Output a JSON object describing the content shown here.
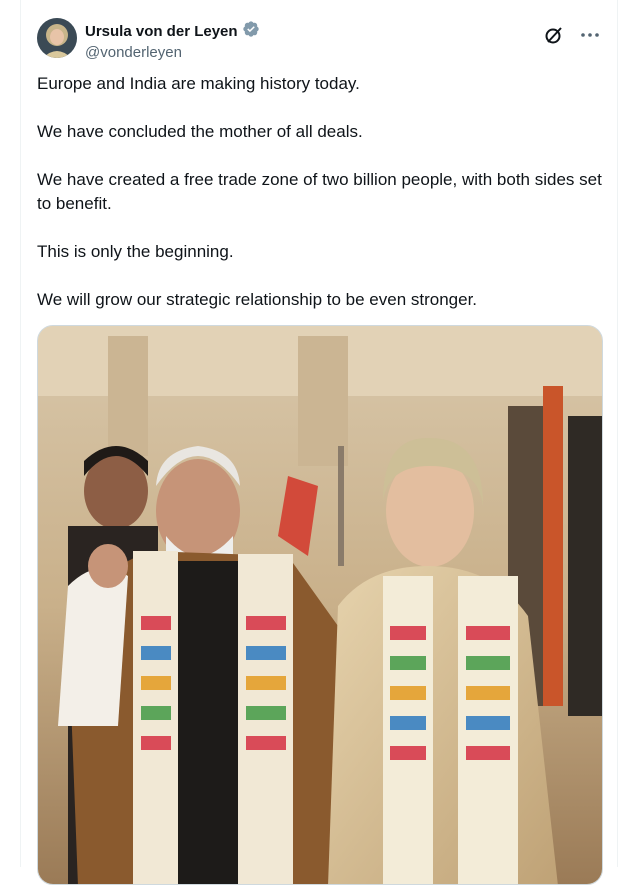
{
  "post": {
    "author": {
      "name": "Ursula von der Leyen",
      "handle": "@vonderleyen",
      "verified_icon": "verified-badge-icon",
      "avatar_icon": "avatar"
    },
    "paragraphs": [
      "Europe and India are making history today.",
      "We have concluded the mother of all deals.",
      "We have created a free trade zone of two billion people, with both sides set to benefit.",
      "This is only the beginning.",
      "We will grow our strategic relationship to be even stronger."
    ],
    "actions": {
      "grok_icon": "grok-icon",
      "more_icon": "more-icon"
    },
    "media": {
      "type": "photo"
    }
  },
  "colors": {
    "text": "#0f1419",
    "secondary": "#536471",
    "verified": "#829aab",
    "border": "#cfd9de"
  }
}
